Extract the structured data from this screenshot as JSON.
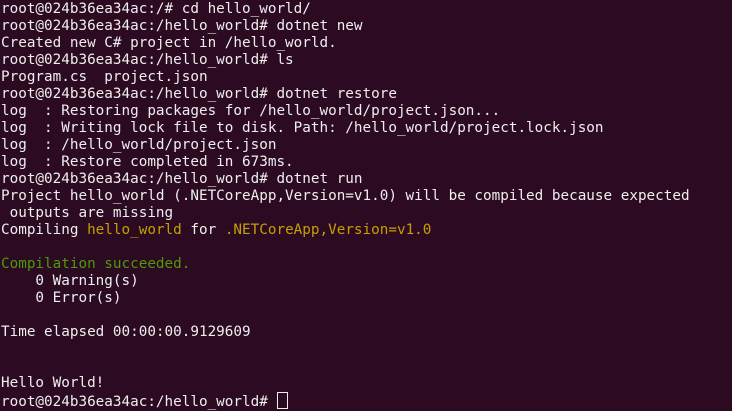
{
  "colors": {
    "background": "#2C0A22",
    "foreground": "#EEEEEC",
    "highlight_yellow": "#C4A000",
    "success_green": "#4E9A06"
  },
  "terminal": {
    "lines": [
      {
        "id": "l1",
        "segments": [
          {
            "text": "root@024b36ea34ac:/# cd hello_world/"
          }
        ]
      },
      {
        "id": "l2",
        "segments": [
          {
            "text": "root@024b36ea34ac:/hello_world# dotnet new"
          }
        ]
      },
      {
        "id": "l3",
        "segments": [
          {
            "text": "Created new C# project in /hello_world."
          }
        ]
      },
      {
        "id": "l4",
        "segments": [
          {
            "text": "root@024b36ea34ac:/hello_world# ls"
          }
        ]
      },
      {
        "id": "l5",
        "segments": [
          {
            "text": "Program.cs  project.json"
          }
        ]
      },
      {
        "id": "l6",
        "segments": [
          {
            "text": "root@024b36ea34ac:/hello_world# dotnet restore"
          }
        ]
      },
      {
        "id": "l7",
        "segments": [
          {
            "text": "log  : Restoring packages for /hello_world/project.json..."
          }
        ]
      },
      {
        "id": "l8",
        "segments": [
          {
            "text": "log  : Writing lock file to disk. Path: /hello_world/project.lock.json"
          }
        ]
      },
      {
        "id": "l9",
        "segments": [
          {
            "text": "log  : /hello_world/project.json"
          }
        ]
      },
      {
        "id": "l10",
        "segments": [
          {
            "text": "log  : Restore completed in 673ms."
          }
        ]
      },
      {
        "id": "l11",
        "segments": [
          {
            "text": "root@024b36ea34ac:/hello_world# dotnet run"
          }
        ]
      },
      {
        "id": "l12",
        "segments": [
          {
            "text": "Project hello_world (.NETCoreApp,Version=v1.0) will be compiled because expected"
          }
        ]
      },
      {
        "id": "l13",
        "segments": [
          {
            "text": " outputs are missing"
          }
        ]
      },
      {
        "id": "l14",
        "segments": [
          {
            "text": "Compiling "
          },
          {
            "text": "hello_world",
            "color": "highlight_yellow"
          },
          {
            "text": " for "
          },
          {
            "text": ".NETCoreApp,Version=v1.0",
            "color": "highlight_yellow"
          }
        ]
      },
      {
        "id": "l15",
        "segments": []
      },
      {
        "id": "l16",
        "segments": [
          {
            "text": "Compilation succeeded.",
            "color": "success_green"
          }
        ]
      },
      {
        "id": "l17",
        "segments": [
          {
            "text": "    0 Warning(s)"
          }
        ]
      },
      {
        "id": "l18",
        "segments": [
          {
            "text": "    0 Error(s)"
          }
        ]
      },
      {
        "id": "l19",
        "segments": []
      },
      {
        "id": "l20",
        "segments": [
          {
            "text": "Time elapsed 00:00:00.9129609"
          }
        ]
      },
      {
        "id": "l21",
        "segments": []
      },
      {
        "id": "l22",
        "segments": []
      },
      {
        "id": "l23",
        "segments": [
          {
            "text": "Hello World!"
          }
        ]
      },
      {
        "id": "l24",
        "segments": [
          {
            "text": "root@024b36ea34ac:/hello_world# "
          }
        ],
        "cursor": true
      }
    ]
  }
}
